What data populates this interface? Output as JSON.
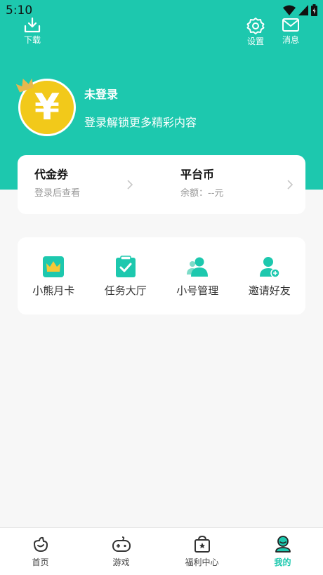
{
  "status": {
    "time": "5:10"
  },
  "header": {
    "download_label": "下载",
    "settings_label": "设置",
    "messages_label": "消息"
  },
  "profile": {
    "username": "未登录",
    "login_hint": "登录解锁更多精彩内容",
    "avatar_symbol": "¥"
  },
  "wallet": {
    "voucher": {
      "title": "代金券",
      "subtitle": "登录后查看"
    },
    "coin": {
      "title": "平台币",
      "subtitle": "余额：--元"
    }
  },
  "services": [
    {
      "label": "小熊月卡",
      "icon": "crown-card-icon"
    },
    {
      "label": "任务大厅",
      "icon": "task-clipboard-icon"
    },
    {
      "label": "小号管理",
      "icon": "sub-account-icon"
    },
    {
      "label": "邀请好友",
      "icon": "invite-friend-icon"
    }
  ],
  "tabbar": {
    "items": [
      {
        "label": "首页",
        "icon": "home-icon"
      },
      {
        "label": "游戏",
        "icon": "gamepad-icon"
      },
      {
        "label": "福利中心",
        "icon": "welfare-icon"
      },
      {
        "label": "我的",
        "icon": "profile-icon",
        "active": true
      }
    ]
  },
  "colors": {
    "accent": "#1dc8ae",
    "coin": "#f2c91a",
    "background": "#f7f7f7"
  }
}
